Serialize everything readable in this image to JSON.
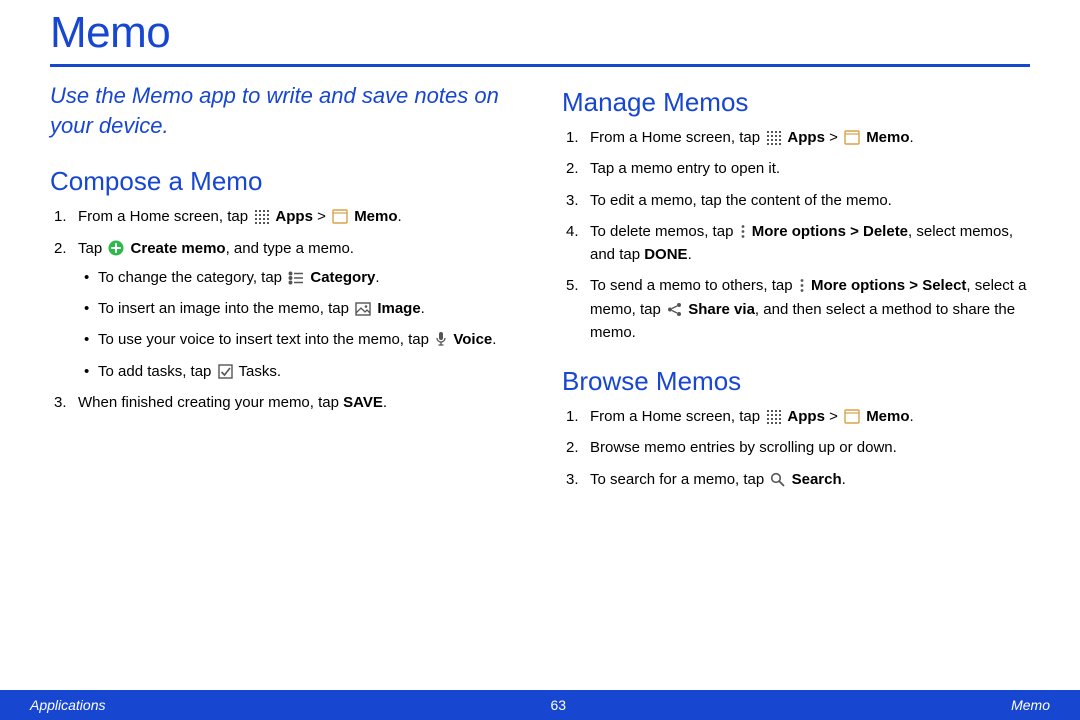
{
  "title": "Memo",
  "lead": "Use the Memo app to write and save notes on your device.",
  "compose": {
    "heading": "Compose a Memo",
    "step1_pre": "From a Home screen, tap ",
    "apps": "Apps",
    "gt": " > ",
    "memo": "Memo",
    "dot": ".",
    "step2_pre": "Tap ",
    "create_memo": "Create memo",
    "step2_post": ", and type a memo.",
    "b1_pre": "To change the category, tap ",
    "category": "Category",
    "b2_pre": "To insert an image into the memo, tap ",
    "image": "Image",
    "b3_pre": "To use your voice to insert text into the memo, tap ",
    "voice": "Voice",
    "b4_pre": "To add tasks, tap ",
    "tasks_post": " Tasks.",
    "step3_pre": "When finished creating your memo, tap ",
    "save": "SAVE"
  },
  "manage": {
    "heading": "Manage Memos",
    "s1_pre": "From a Home screen, tap ",
    "s2": "Tap a memo entry to open it.",
    "s3": "To edit a memo, tap the content of the memo.",
    "s4_pre": "To delete memos, tap ",
    "more_delete": "More options > Delete",
    "s4_mid": ", select memos, and tap ",
    "done": "DONE",
    "s5_pre": "To send a memo to others, tap ",
    "more_select": "More options > Select",
    "s5_mid": ", select a memo, tap ",
    "share_via": "Share via",
    "s5_post": ", and then select a method to share the memo."
  },
  "browse": {
    "heading": "Browse Memos",
    "s1_pre": "From a Home screen, tap ",
    "s2": "Browse memo entries by scrolling up or down.",
    "s3_pre": "To search for a memo, tap ",
    "search": "Search"
  },
  "footer": {
    "left": "Applications",
    "page": "63",
    "right": "Memo"
  }
}
